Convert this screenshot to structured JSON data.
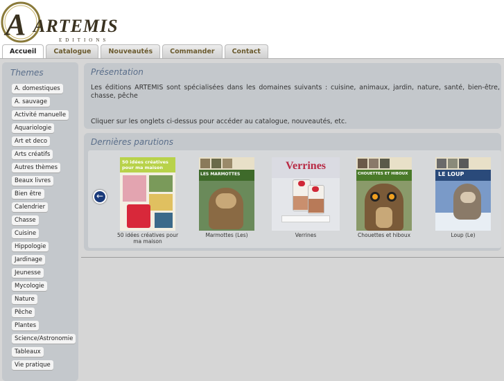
{
  "brand": {
    "name": "ARTEMIS",
    "subtitle": "EDITIONS"
  },
  "tabs": [
    {
      "label": "Accueil",
      "active": true
    },
    {
      "label": "Catalogue",
      "active": false
    },
    {
      "label": "Nouveautés",
      "active": false
    },
    {
      "label": "Commander",
      "active": false
    },
    {
      "label": "Contact",
      "active": false
    }
  ],
  "sidebar": {
    "title": "Themes",
    "items": [
      "A. domestiques",
      "A. sauvage",
      "Activité manuelle",
      "Aquariologie",
      "Art et deco",
      "Arts créatifs",
      "Autres thèmes",
      "Beaux livres",
      "Bien être",
      "Calendrier",
      "Chasse",
      "Cuisine",
      "Hippologie",
      "Jardinage",
      "Jeunesse",
      "Mycologie",
      "Nature",
      "Pêche",
      "Plantes",
      "Science/Astronomie",
      "Tableaux",
      "Vie pratique"
    ]
  },
  "presentation": {
    "title": "Présentation",
    "text": "Les éditions ARTEMIS sont spécialisées dans les domaines suivants : cuisine, animaux, jardin, nature, santé, bien-être, chasse, pêche",
    "text2": "Cliquer sur les onglets ci-dessus pour accéder au catalogue, nouveautés, etc."
  },
  "parutions": {
    "title": "Dernières parutions",
    "prev_icon": "arrow-left-icon",
    "books": [
      {
        "title": "50 idées créatives pour ma maison",
        "cover_text": "50 idées créatives pour ma maison"
      },
      {
        "title": "Marmottes (Les)",
        "cover_text": "LES MARMOTTES"
      },
      {
        "title": "Verrines",
        "cover_text": "Verrines"
      },
      {
        "title": "Chouettes et hiboux",
        "cover_text": "CHOUETTES ET HIBOUX"
      },
      {
        "title": "Loup (Le)",
        "cover_text": "LE LOUP"
      }
    ]
  },
  "colors": {
    "accent": "#5a6e8a",
    "panel": "#c4c8cc",
    "tab_text": "#6a5a2e"
  }
}
